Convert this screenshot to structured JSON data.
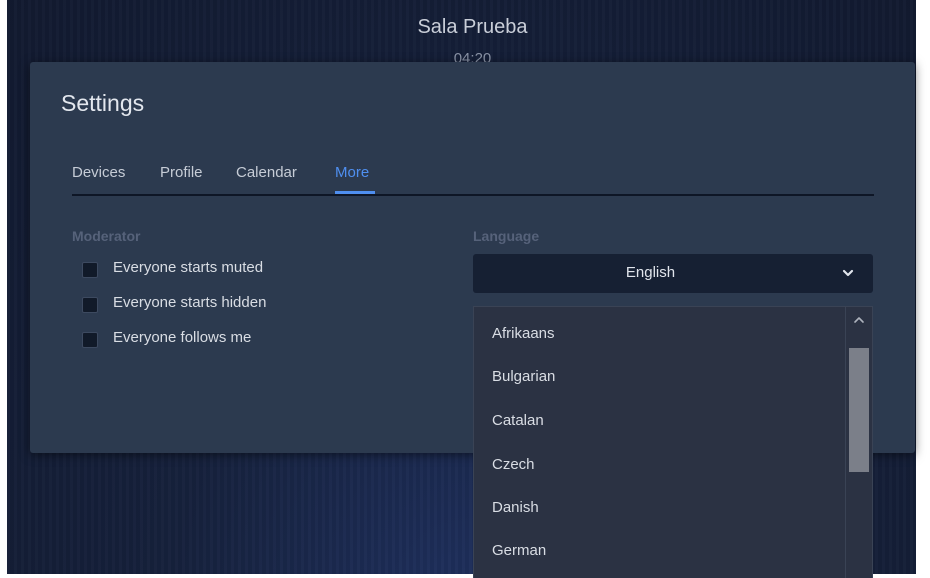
{
  "room": {
    "title": "Sala Prueba",
    "timer": "04:20"
  },
  "dialog": {
    "title": "Settings",
    "tabs": [
      {
        "label": "Devices",
        "active": false
      },
      {
        "label": "Profile",
        "active": false
      },
      {
        "label": "Calendar",
        "active": false
      },
      {
        "label": "More",
        "active": true
      }
    ]
  },
  "moderator": {
    "label": "Moderator",
    "options": [
      {
        "label": "Everyone starts muted",
        "checked": false
      },
      {
        "label": "Everyone starts hidden",
        "checked": false
      },
      {
        "label": "Everyone follows me",
        "checked": false
      }
    ]
  },
  "language": {
    "label": "Language",
    "selected": "English",
    "options": [
      "Afrikaans",
      "Bulgarian",
      "Catalan",
      "Czech",
      "Danish",
      "German"
    ]
  },
  "colors": {
    "accent": "#4f8ff0",
    "dialog_bg": "#2c3a4f",
    "select_bg": "#162033",
    "dropdown_bg": "#2b3243"
  },
  "icons": {
    "select_chevron": "chevron-down-icon",
    "scroll_up": "chevron-up-icon"
  }
}
